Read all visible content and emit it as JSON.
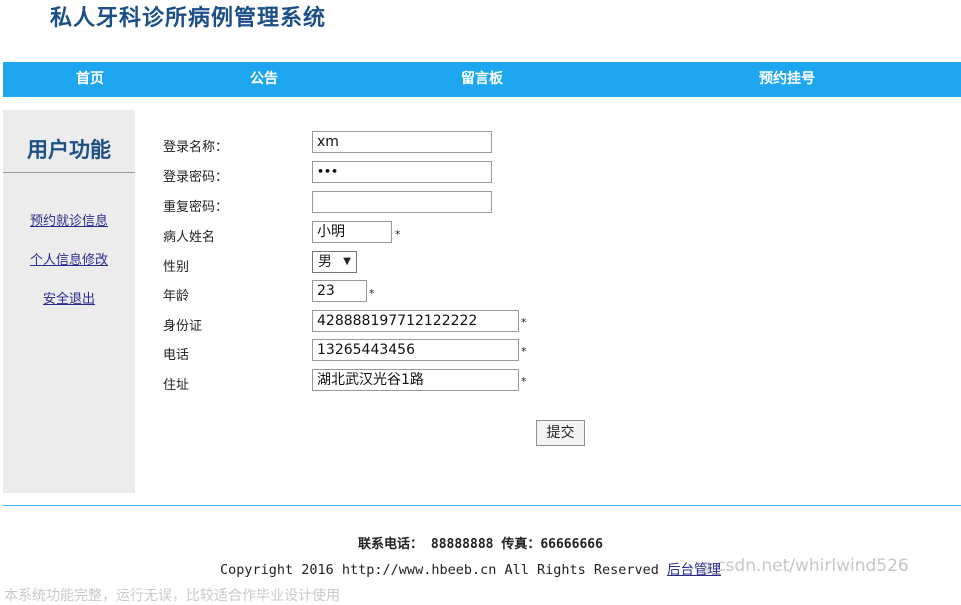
{
  "site_title": "私人牙科诊所病例管理系统",
  "nav": {
    "home": "首页",
    "notice": "公告",
    "board": "留言板",
    "appointment": "预约挂号"
  },
  "sidebar": {
    "title": "用户功能",
    "links": [
      "预约就诊信息",
      "个人信息修改",
      "安全退出"
    ]
  },
  "form": {
    "login_name_label": "登录名称：",
    "login_name_value": "xm",
    "password_label": "登录密码：",
    "password_value": "•••",
    "repeat_password_label": "重复密码：",
    "repeat_password_value": "",
    "patient_name_label": "病人姓名",
    "patient_name_value": "小明",
    "gender_label": "性别",
    "gender_value": "男",
    "age_label": "年龄",
    "age_value": "23",
    "id_label": "身份证",
    "id_value": "428888197712122222",
    "phone_label": "电话",
    "phone_value": "13265443456",
    "address_label": "住址",
    "address_value": "湖北武汉光谷1路",
    "required_mark": "*",
    "submit_label": "提交"
  },
  "footer": {
    "contact": "联系电话： 88888888 传真：66666666",
    "copyright": "Copyright 2016 http://www.hbeeb.cn All Rights Reserved ",
    "admin_link": "后台管理",
    "watermark": "g.csdn.net/whirlwind526",
    "faded_text": "本系统功能完整，运行无误，比较适合作毕业设计使用"
  }
}
